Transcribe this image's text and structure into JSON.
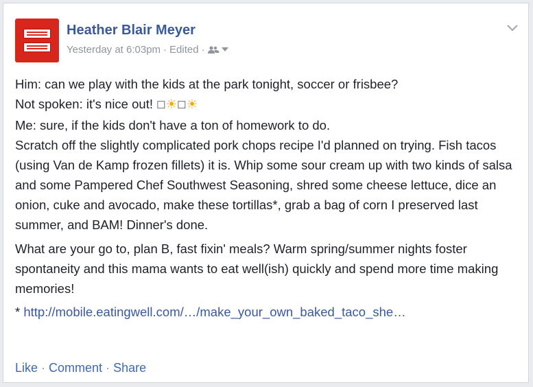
{
  "post": {
    "author": "Heather Blair Meyer",
    "timestamp": "Yesterday at 6:03pm",
    "edited": "Edited",
    "separator": "·",
    "audience_icon": "friends-icon",
    "menu_icon": "chevron-down-icon",
    "lines": [
      "Him: can we play with the kids at the park tonight, soccer or frisbee?",
      "Not spoken: it's nice out!",
      "Me: sure, if the kids don't have a ton of homework to do.",
      "Scratch off the slightly complicated pork chops recipe I'd planned on trying. Fish tacos (using Van de Kamp frozen fillets) it is. Whip some sour cream up with two kinds of salsa and some Pampered Chef Southwest Seasoning, shred some cheese lettuce, dice an onion, cuke and avocado, make these tortillas*, grab a bag of corn I preserved last summer, and BAM! Dinner's done."
    ],
    "emoji_box": "☐",
    "emoji_sun": "☀",
    "paragraph2": "What are your go to, plan B, fast fixin' meals? Warm spring/summer nights foster spontaneity and this mama wants to eat well(ish) quickly and spend more time making memories!",
    "footnote_prefix": "* ",
    "link_text": "http://mobile.eatingwell.com/…/make_your_own_baked_taco_she…"
  },
  "actions": {
    "like": "Like",
    "comment": "Comment",
    "share": "Share",
    "separator": "·"
  },
  "colors": {
    "link": "#3b5998",
    "text": "#1d2129",
    "meta": "#90949c",
    "avatar": "#d9261c"
  }
}
